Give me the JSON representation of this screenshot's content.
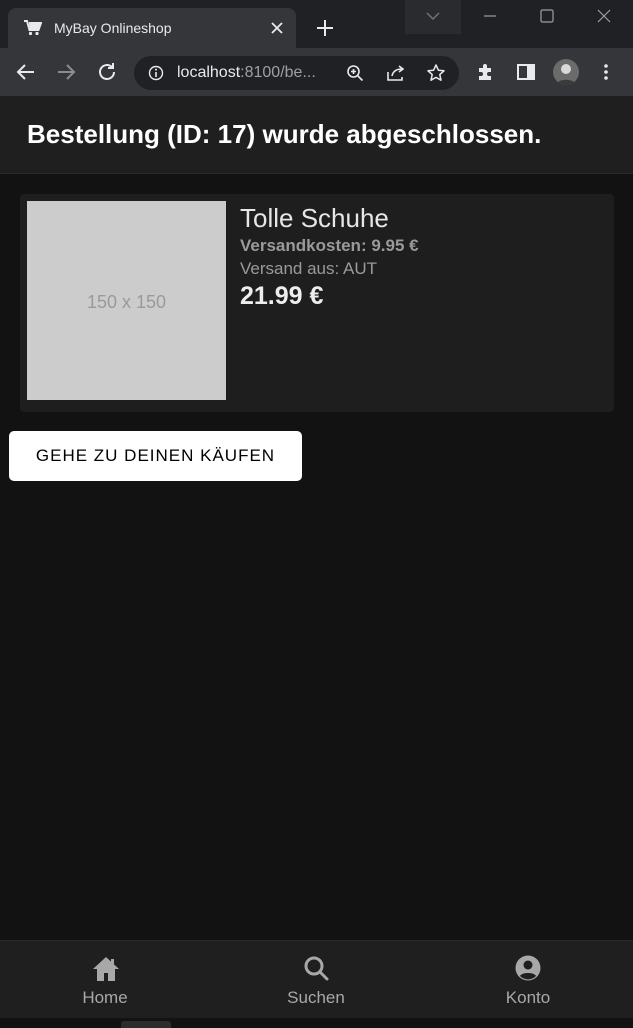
{
  "browser": {
    "tab_title": "MyBay Onlineshop",
    "url_host": "localhost",
    "url_path": ":8100/be..."
  },
  "page": {
    "title": "Bestellung (ID: 17) wurde abgeschlossen."
  },
  "order_item": {
    "image_placeholder": "150 x 150",
    "name": "Tolle Schuhe",
    "shipping_cost": "Versandkosten: 9.95 €",
    "ships_from": "Versand aus: AUT",
    "price": "21.99 €"
  },
  "actions": {
    "go_to_purchases": "GEHE ZU DEINEN KÄUFEN"
  },
  "tabbar": {
    "items": [
      {
        "label": "Home",
        "icon": "home-icon"
      },
      {
        "label": "Suchen",
        "icon": "search-icon"
      },
      {
        "label": "Konto",
        "icon": "account-icon"
      }
    ]
  },
  "colors": {
    "background": "#121212",
    "header": "#1f1f1f",
    "card": "#1e1e1e",
    "button": "#ffffff"
  }
}
